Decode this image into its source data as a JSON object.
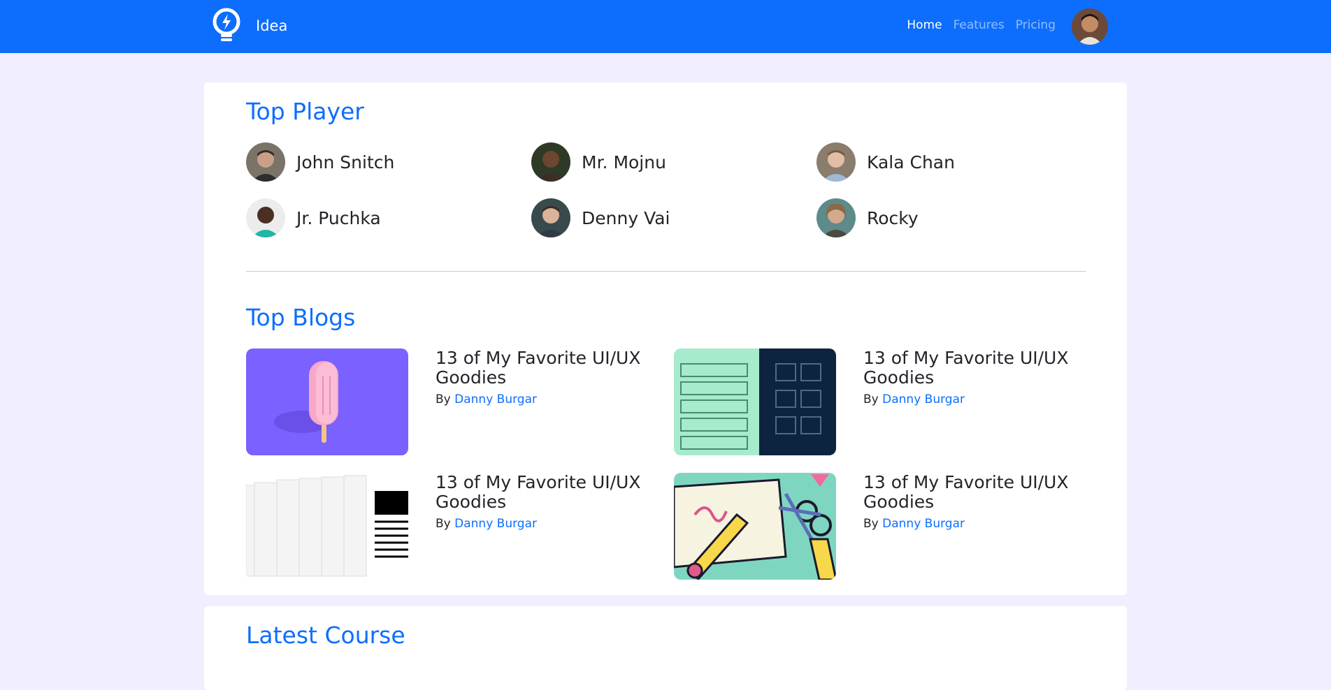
{
  "navbar": {
    "brand": "Idea",
    "links": [
      "Home",
      "Features",
      "Pricing"
    ],
    "active_link": "Home"
  },
  "top_player": {
    "title": "Top Player",
    "players": [
      {
        "name": "John Snitch"
      },
      {
        "name": "Mr. Mojnu"
      },
      {
        "name": "Kala Chan"
      },
      {
        "name": "Jr. Puchka"
      },
      {
        "name": "Denny Vai"
      },
      {
        "name": "Rocky"
      }
    ]
  },
  "top_blogs": {
    "title": "Top Blogs",
    "posts": [
      {
        "title": "13 of My Favorite UI/UX Goodies",
        "by": "By",
        "author": "Danny Burgar"
      },
      {
        "title": "13 of My Favorite UI/UX Goodies",
        "by": "By",
        "author": "Danny Burgar"
      },
      {
        "title": "13 of My Favorite UI/UX Goodies",
        "by": "By",
        "author": "Danny Burgar"
      },
      {
        "title": "13 of My Favorite UI/UX Goodies",
        "by": "By",
        "author": "Danny Burgar"
      }
    ]
  },
  "latest_course": {
    "title": "Latest Course"
  },
  "colors": {
    "primary": "#0d6efd",
    "page_bg": "#f1efff"
  }
}
